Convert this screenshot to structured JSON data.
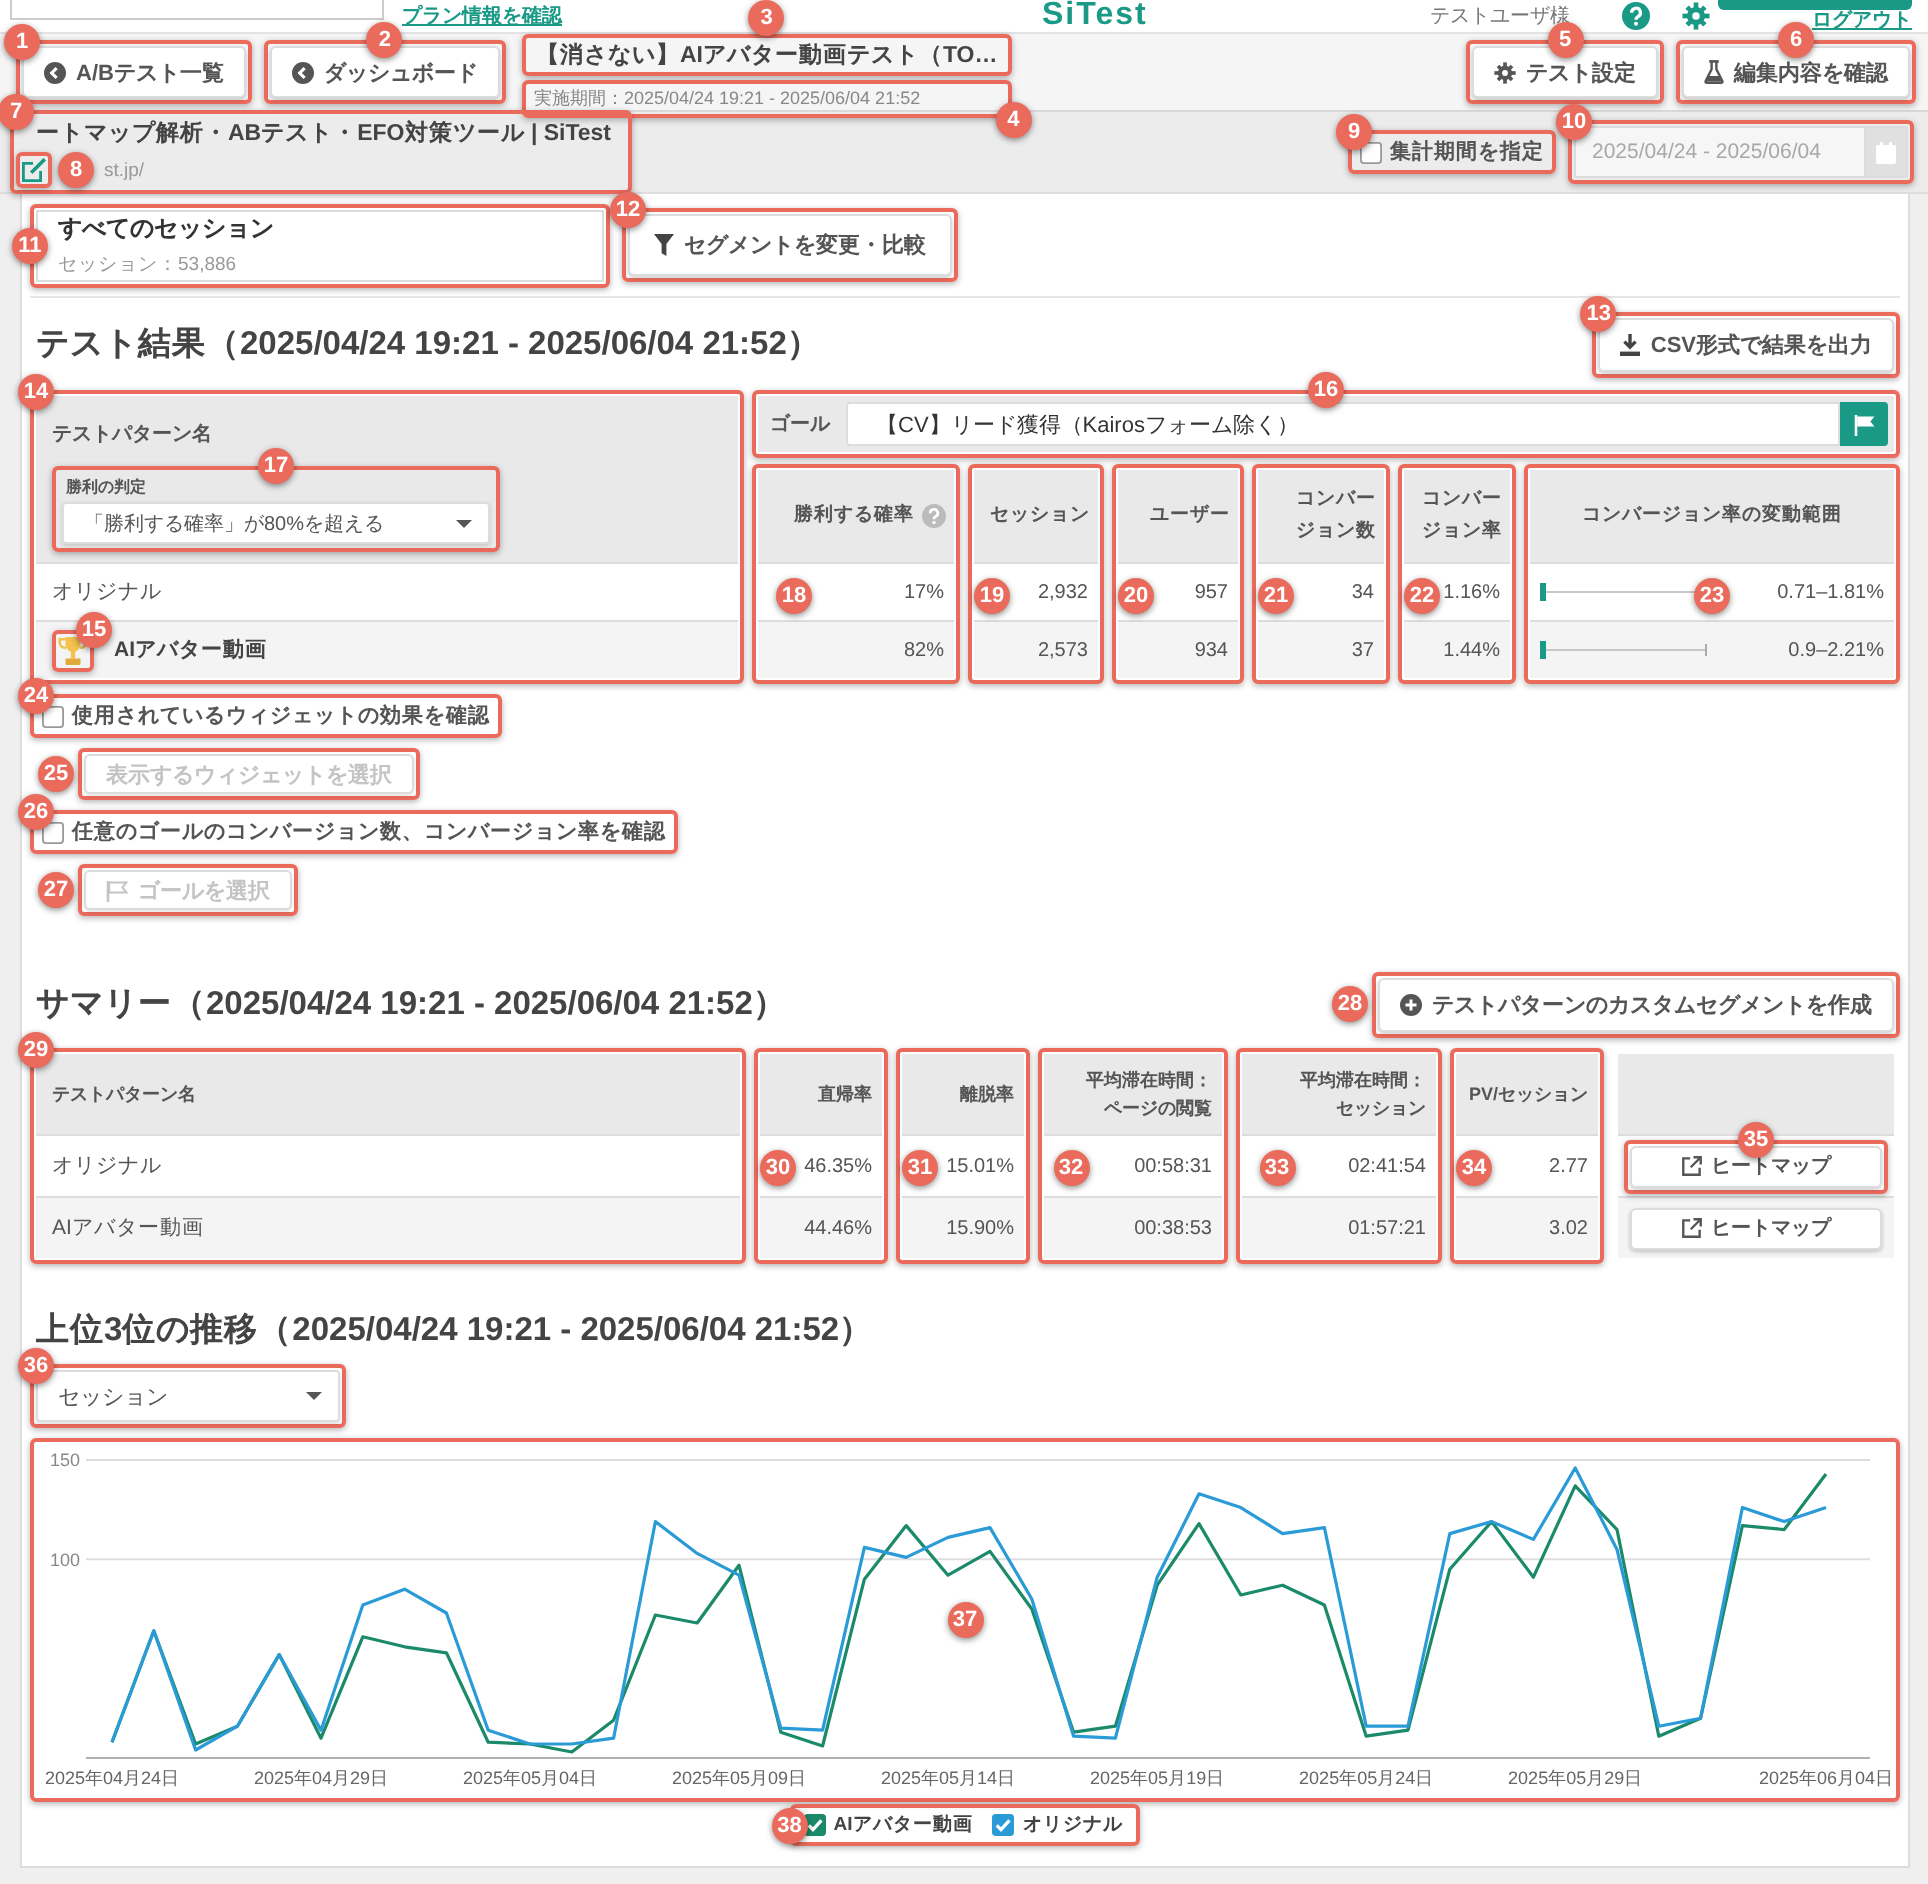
{
  "header": {
    "plan_link": "プラン情報を確認",
    "logo": "SiTest",
    "user": "テストユーザ様",
    "logout_link": "ログアウト"
  },
  "toolbar": {
    "nav_buttons": [
      {
        "label": "A/Bテスト一覧",
        "callout": "1"
      },
      {
        "label": "ダッシュボード",
        "callout": "2"
      }
    ],
    "test_title": {
      "text": "【消さない】AIアバター動画テスト（TO…",
      "callout": "3"
    },
    "test_period": {
      "text": "実施期間：2025/04/24 19:21 - 2025/06/04 21:52",
      "callout": "4"
    },
    "settings_button": {
      "label": "テスト設定",
      "callout": "5"
    },
    "preview_button": {
      "label": "編集内容を確認",
      "callout": "6"
    }
  },
  "page": {
    "title": "ートマップ解析・ABテスト・EFO対策ツール | SiTest",
    "callout": "7",
    "edit_callout": "8",
    "url": "st.jp/"
  },
  "period": {
    "checkbox": {
      "label": "集計期間を指定",
      "checked": false,
      "callout": "9"
    },
    "date_range": {
      "value": "2025/04/24 - 2025/06/04",
      "disabled": true,
      "callout": "10"
    }
  },
  "segment": {
    "title": "すべてのセッション",
    "sessions": "セッション：53,886",
    "callout": "11",
    "button": {
      "label": "セグメントを変更・比較",
      "callout": "12"
    }
  },
  "results": {
    "heading": "テスト結果（2025/04/24 19:21 - 2025/06/04 21:52）",
    "csv_button": {
      "label": "CSV形式で結果を出力",
      "callout": "13"
    },
    "pattern_column": {
      "header": "テストパターン名",
      "callout": "14",
      "judge": {
        "label": "勝利の判定",
        "value": "「勝利する確率」が80%を超える",
        "callout": "17"
      }
    },
    "patterns": [
      {
        "name": "オリジナル",
        "winner": false
      },
      {
        "name": "AIアバター動画",
        "winner": true,
        "callout": "15"
      }
    ],
    "goal": {
      "label": "ゴール",
      "value": "【CV】リード獲得（Kairosフォーム除く）",
      "callout": "16"
    },
    "columns": [
      {
        "kind": "number",
        "header": "勝利する確率",
        "help": true,
        "callout": "18",
        "values": [
          "17%",
          "82%"
        ]
      },
      {
        "kind": "number",
        "header": "セッション",
        "help": false,
        "callout": "19",
        "values": [
          "2,932",
          "2,573"
        ]
      },
      {
        "kind": "number",
        "header": "ユーザー",
        "help": false,
        "callout": "20",
        "values": [
          "957",
          "934"
        ]
      },
      {
        "kind": "number",
        "header": "コンバージョン数",
        "help": false,
        "callout": "21",
        "values": [
          "34",
          "37"
        ]
      },
      {
        "kind": "number",
        "header": "コンバージョン率",
        "help": false,
        "callout": "22",
        "values": [
          "1.16%",
          "1.44%"
        ]
      },
      {
        "kind": "range",
        "header": "コンバージョン率の変動範囲",
        "help": false,
        "callout": "23",
        "values": [
          "0.71–1.81%",
          "0.9–2.21%"
        ]
      }
    ],
    "widget_toggle": {
      "label": "使用されているウィジェットの効果を確認",
      "checked": false,
      "callout": "24"
    },
    "widget_button": {
      "label": "表示するウィジェットを選択",
      "disabled": true,
      "callout": "25"
    },
    "goal_toggle": {
      "label": "任意のゴールのコンバージョン数、コンバージョン率を確認",
      "checked": false,
      "callout": "26"
    },
    "goal_button": {
      "label": "ゴールを選択",
      "disabled": true,
      "callout": "27"
    }
  },
  "summary": {
    "heading": "サマリー（2025/04/24 19:21 - 2025/06/04 21:52）",
    "segment_button": {
      "label": "テストパターンのカスタムセグメントを作成",
      "callout": "28"
    },
    "name_column": {
      "header": "テストパターン名",
      "callout": "29",
      "names": [
        "オリジナル",
        "AIアバター動画"
      ]
    },
    "columns": [
      {
        "header": "直帰率",
        "callout": "30",
        "values": [
          "46.35%",
          "44.46%"
        ]
      },
      {
        "header": "離脱率",
        "callout": "31",
        "values": [
          "15.01%",
          "15.90%"
        ]
      },
      {
        "header": "平均滞在時間：ページの閲覧",
        "callout": "32",
        "values": [
          "00:58:31",
          "00:38:53"
        ]
      },
      {
        "header": "平均滞在時間：セッション",
        "callout": "33",
        "values": [
          "02:41:54",
          "01:57:21"
        ]
      },
      {
        "header": "PV/セッション",
        "callout": "34",
        "values": [
          "2.77",
          "3.02"
        ]
      }
    ],
    "heatmap_buttons": [
      {
        "label": "ヒートマップ",
        "callout": "35"
      },
      {
        "label": "ヒートマップ"
      }
    ]
  },
  "trend": {
    "heading": "上位3位の推移（2025/04/24 19:21 - 2025/06/04 21:52）",
    "metric_select": {
      "value": "セッション",
      "callout": "36"
    },
    "chart": {
      "callout": "37",
      "chart_data": {
        "type": "line",
        "categories": [
          "2025年04月24日",
          null,
          null,
          null,
          null,
          "2025年04月29日",
          null,
          null,
          null,
          null,
          "2025年05月04日",
          null,
          null,
          null,
          null,
          "2025年05月09日",
          null,
          null,
          null,
          null,
          "2025年05月14日",
          null,
          null,
          null,
          null,
          "2025年05月19日",
          null,
          null,
          null,
          null,
          "2025年05月24日",
          null,
          null,
          null,
          null,
          "2025年05月29日",
          null,
          null,
          null,
          null,
          null,
          "2025年06月04日"
        ],
        "series": [
          {
            "name": "AIアバター動画",
            "color": "#1a8a6a",
            "values": [
              8,
              64,
              7,
              16,
              52,
              10,
              61,
              56,
              53,
              8,
              7,
              3,
              19,
              72,
              68,
              97,
              13,
              6,
              90,
              117,
              92,
              104,
              75,
              13,
              16,
              87,
              118,
              82,
              87,
              77,
              11,
              14,
              95,
              119,
              91,
              137,
              115,
              11,
              20,
              117,
              115,
              143
            ]
          },
          {
            "name": "オリジナル",
            "color": "#2a9bd6",
            "values": [
              8,
              64,
              4,
              16,
              52,
              14,
              77,
              85,
              73,
              14,
              7,
              7,
              10,
              119,
              103,
              92,
              15,
              14,
              106,
              101,
              111,
              116,
              80,
              11,
              10,
              91,
              133,
              126,
              113,
              116,
              16,
              16,
              113,
              119,
              110,
              146,
              105,
              16,
              20,
              126,
              119,
              126
            ]
          }
        ],
        "ylim": [
          0,
          150
        ],
        "yticks": [
          100,
          150
        ]
      }
    },
    "legend": {
      "callout": "38",
      "items": [
        {
          "checked": true
        },
        {
          "checked": true
        }
      ]
    }
  }
}
